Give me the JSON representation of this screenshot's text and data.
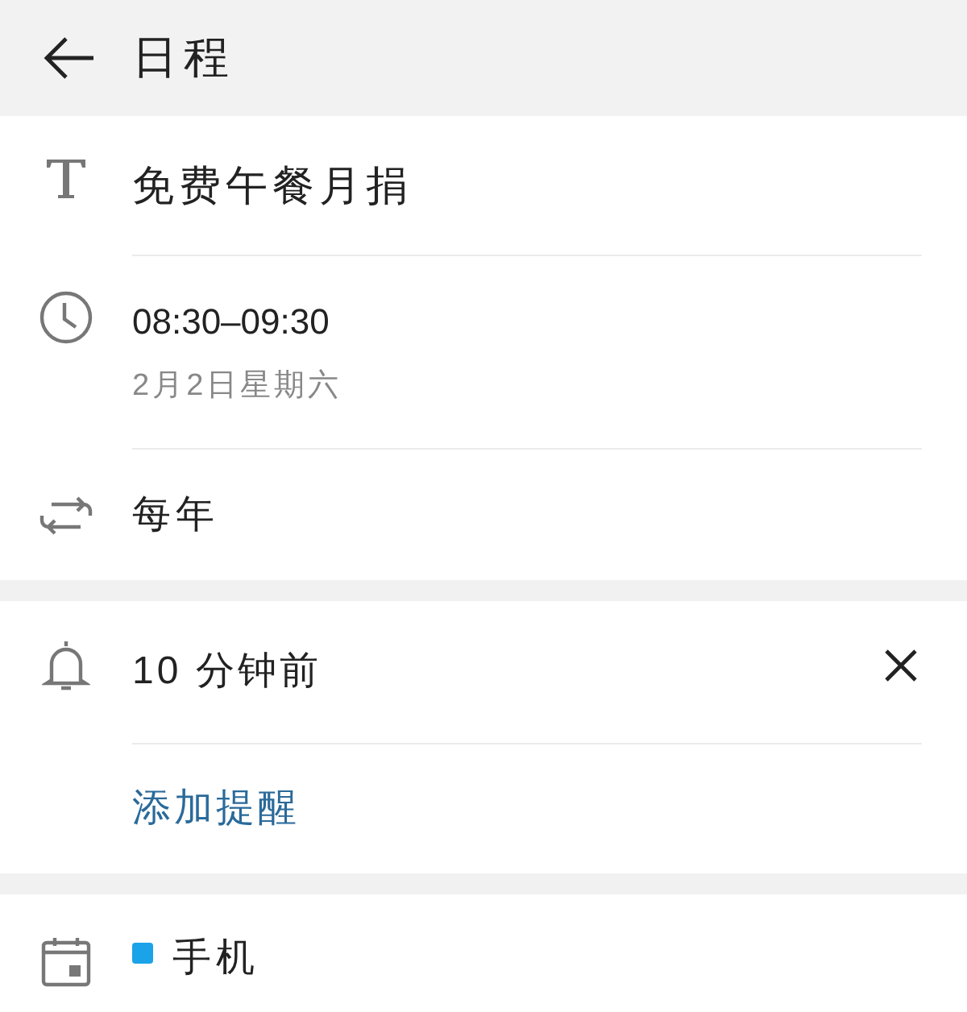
{
  "header": {
    "title": "日程"
  },
  "event_title": "免费午餐月捐",
  "time": {
    "range": "08:30–09:30",
    "date": "2月2日星期六"
  },
  "repeat": "每年",
  "reminders": [
    {
      "text": "10 分钟前"
    }
  ],
  "add_reminder": "添加提醒",
  "calendar": {
    "name": "手机",
    "color": "#1aa3e8"
  }
}
